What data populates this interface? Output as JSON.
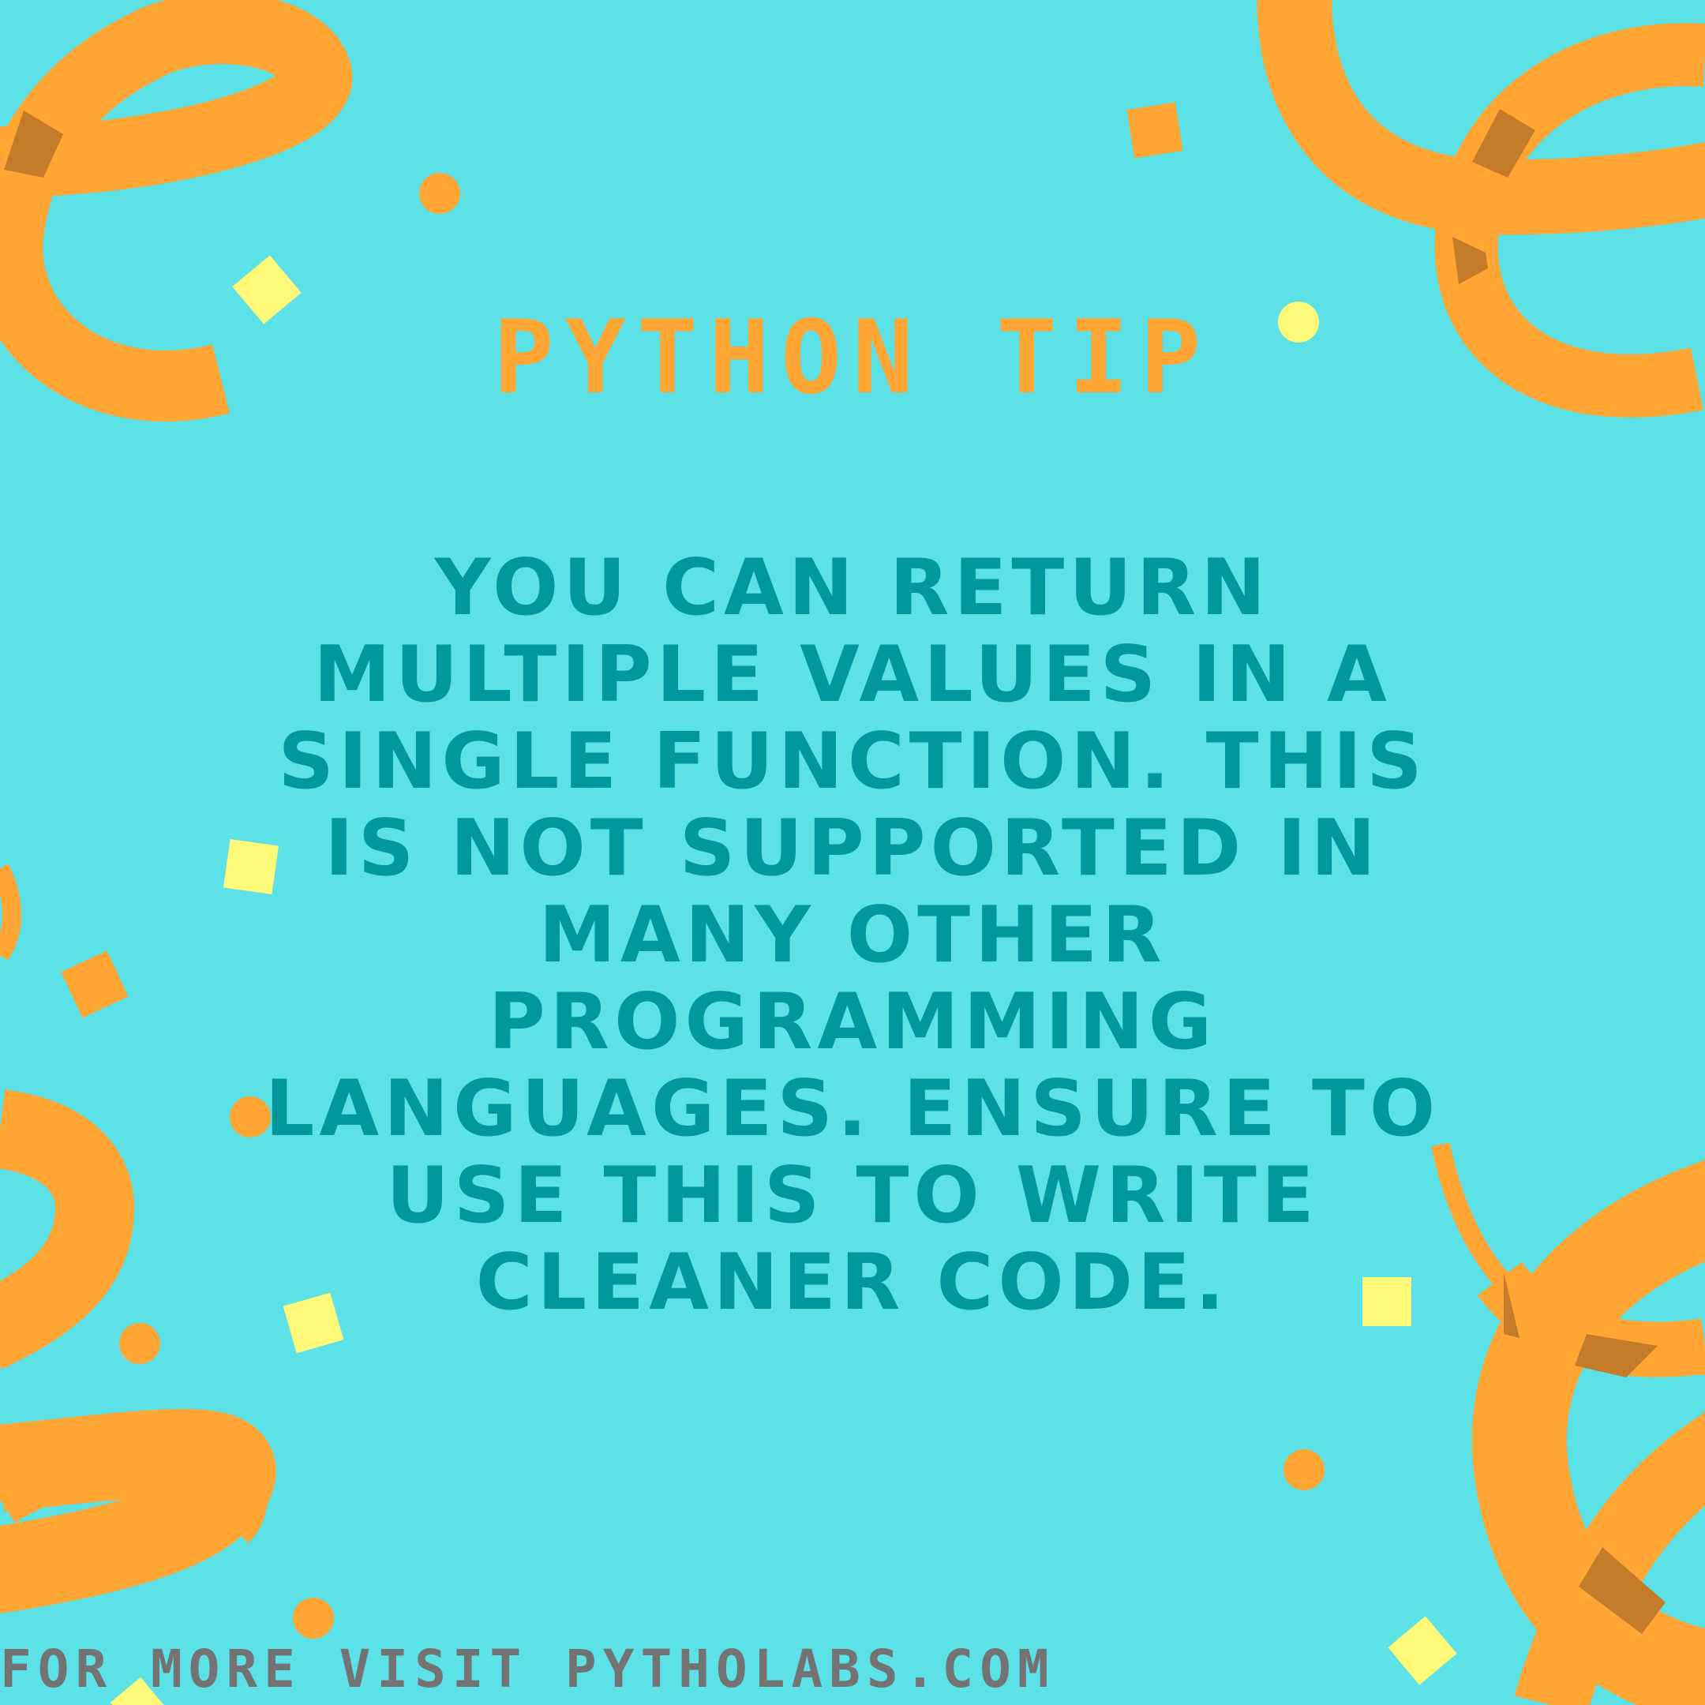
{
  "header": {
    "title": "PYTHON TIP"
  },
  "tip": {
    "text": "YOU CAN RETURN MULTIPLE VALUES IN A SINGLE FUNCTION. THIS IS NOT SUPPORTED IN MANY OTHER PROGRAMMING LANGUAGES. ENSURE TO USE THIS TO WRITE CLEANER CODE."
  },
  "footer": {
    "text": "FOR MORE VISIT PYTHOLABS.COM"
  },
  "colors": {
    "background": "#5ce1e6",
    "accent_orange": "#ffa534",
    "accent_yellow": "#fff97a",
    "tip_text": "#00989c",
    "footer_text": "#737373"
  }
}
